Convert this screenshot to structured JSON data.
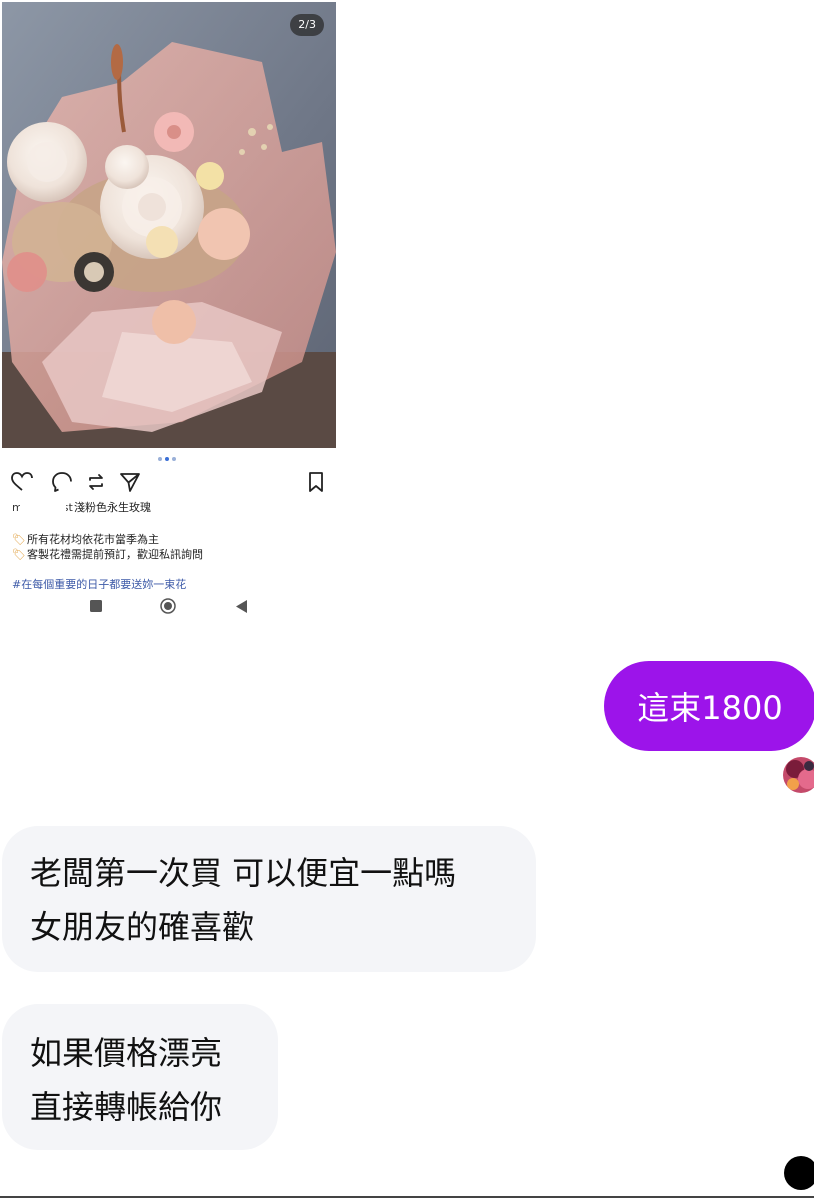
{
  "post": {
    "counter": "2/3",
    "username_visible": "m",
    "username_suffix": "st",
    "title": "淺粉色永生玫瑰",
    "notes": [
      "所有花材均依花市當季為主",
      "客製花禮需提前預訂，歡迎私訊詢問"
    ],
    "hashtag": "#在每個重要的日子都要送妳一束花",
    "icons": [
      "heart-icon",
      "comment-icon",
      "repost-icon",
      "send-icon",
      "bookmark-icon"
    ]
  },
  "system_nav": {
    "icons": [
      "recent-apps-icon",
      "home-icon",
      "back-icon"
    ]
  },
  "messages": {
    "outgoing": {
      "text": "這束1800",
      "color": "#9c14ea"
    },
    "incoming": [
      {
        "lines": [
          "老闆第一次買 可以便宜一點嗎",
          "女朋友的確喜歡"
        ]
      },
      {
        "lines": [
          "如果價格漂亮",
          "直接轉帳給你"
        ]
      }
    ]
  },
  "colors": {
    "bubble_out": "#9c14ea",
    "bubble_in": "#f4f5f8",
    "hashtag": "#3d5aa8"
  }
}
